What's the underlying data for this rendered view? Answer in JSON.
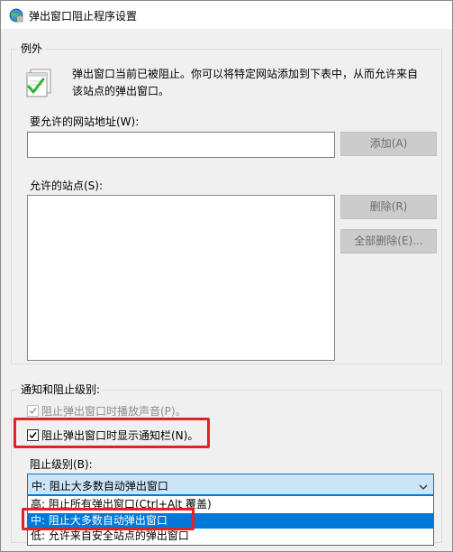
{
  "window": {
    "title": "弹出窗口阻止程序设置"
  },
  "exceptions": {
    "legend": "例外",
    "description_line1": "弹出窗口当前已被阻止。你可以将特定网站添加到下表中，从而允许来自",
    "description_line2": "该站点的弹出窗口。",
    "address_label": "要允许的网站地址(W):",
    "address_value": "",
    "add_button": "添加(A)",
    "allowed_label": "允许的站点(S):",
    "allowed_sites": [],
    "remove_button": "删除(R)",
    "remove_all_button": "全部删除(E)..."
  },
  "notifications": {
    "legend": "通知和阻止级别:",
    "play_sound_label": "阻止弹出窗口时播放声音(P)。",
    "play_sound_checked": true,
    "show_bar_label": "阻止弹出窗口时显示通知栏(N)。",
    "show_bar_checked": true,
    "level_label": "阻止级别(B):",
    "level_selected": "中: 阻止大多数自动弹出窗口",
    "level_options": [
      "高: 阻止所有弹出窗口(Ctrl+Alt 覆盖)",
      "中: 阻止大多数自动弹出窗口",
      "低: 允许来自安全站点的弹出窗口"
    ]
  },
  "colors": {
    "selection": "#0078d7",
    "highlight_box": "#e32228",
    "checkmark_icon": "#2db52d"
  },
  "icons": {
    "app": "internet-options-icon",
    "info": "popup-allowed-icon",
    "dropdown": "chevron-down-icon"
  }
}
